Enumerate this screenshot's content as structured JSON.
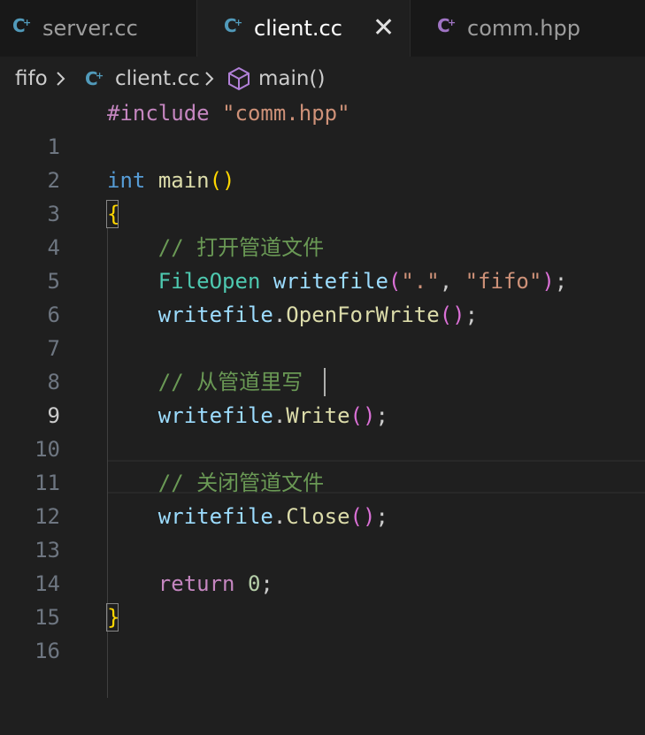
{
  "tabs": [
    {
      "label": "server.cc",
      "icon": "cpp-icon",
      "active": false
    },
    {
      "label": "client.cc",
      "icon": "cpp-icon",
      "active": true
    },
    {
      "label": "comm.hpp",
      "icon": "cpp-icon",
      "active": false
    }
  ],
  "breadcrumb": {
    "folder": "fifo",
    "file": "client.cc",
    "symbol": "main()",
    "separator": ">"
  },
  "editor": {
    "line_numbers": [
      "1",
      "2",
      "3",
      "4",
      "5",
      "6",
      "7",
      "8",
      "9",
      "10",
      "11",
      "12",
      "13",
      "14",
      "15",
      "16"
    ],
    "current_line": 9,
    "lines": {
      "l1_directive": "#include",
      "l1_string": "\"comm.hpp\"",
      "l3_type": "int",
      "l3_func": "main",
      "l5_comment": "// 打开管道文件",
      "l6_type": "FileOpen",
      "l6_var": "writefile",
      "l6_arg1": "\".\"",
      "l6_arg2": "\"fifo\"",
      "l7_var": "writefile",
      "l7_method": "OpenForWrite",
      "l9_comment": "// 从管道里写",
      "l10_var": "writefile",
      "l10_method": "Write",
      "l12_comment": "// 关闭管道文件",
      "l13_var": "writefile",
      "l13_method": "Close",
      "l15_keyword": "return",
      "l15_value": "0"
    }
  },
  "colors": {
    "background": "#1f1f1f",
    "keyword": "#569cd6",
    "string": "#ce9178",
    "function": "#dcdcaa",
    "type": "#4ec9b0",
    "variable": "#9cdcfe",
    "comment": "#6a9955",
    "cpp_icon": "#519aba",
    "cpp_icon_header": "#a074c4"
  }
}
